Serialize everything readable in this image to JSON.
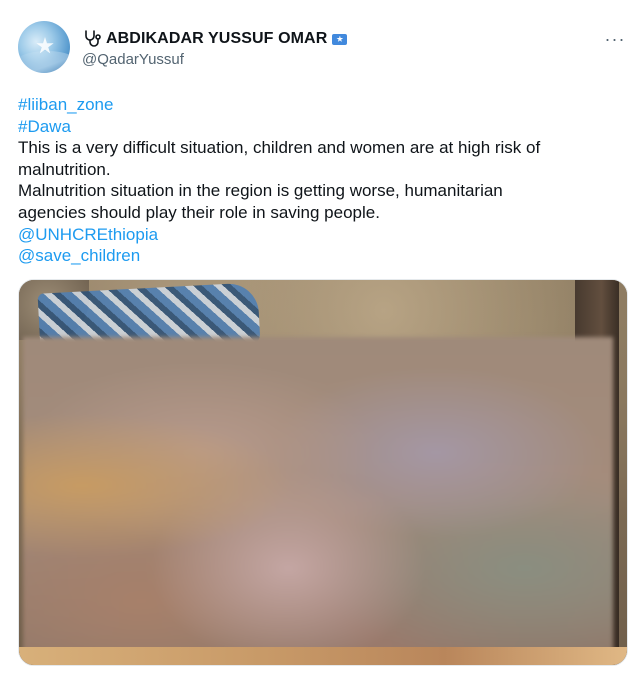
{
  "author": {
    "display_name": "ABDIKADAR YUSSUF OMAR",
    "handle": "@QadarYussuf",
    "name_prefix_icon": "stethoscope-icon",
    "name_suffix_icon": "somalia-flag-icon"
  },
  "menu": {
    "more_label": "···"
  },
  "tweet": {
    "hashtag_1": "#liiban_zone",
    "hashtag_2": "#Dawa",
    "line_1": "This is a very difficult situation, children and women are at high risk of",
    "line_2": "malnutrition.",
    "line_3": "Malnutrition situation in the region is getting worse, humanitarian",
    "line_4": "agencies should play their role in saving people.",
    "mention_1": "@UNHCREthiopia",
    "mention_2": "@save_children"
  },
  "colors": {
    "link": "#1d9bf0",
    "text": "#0f1419",
    "secondary": "#536471"
  }
}
